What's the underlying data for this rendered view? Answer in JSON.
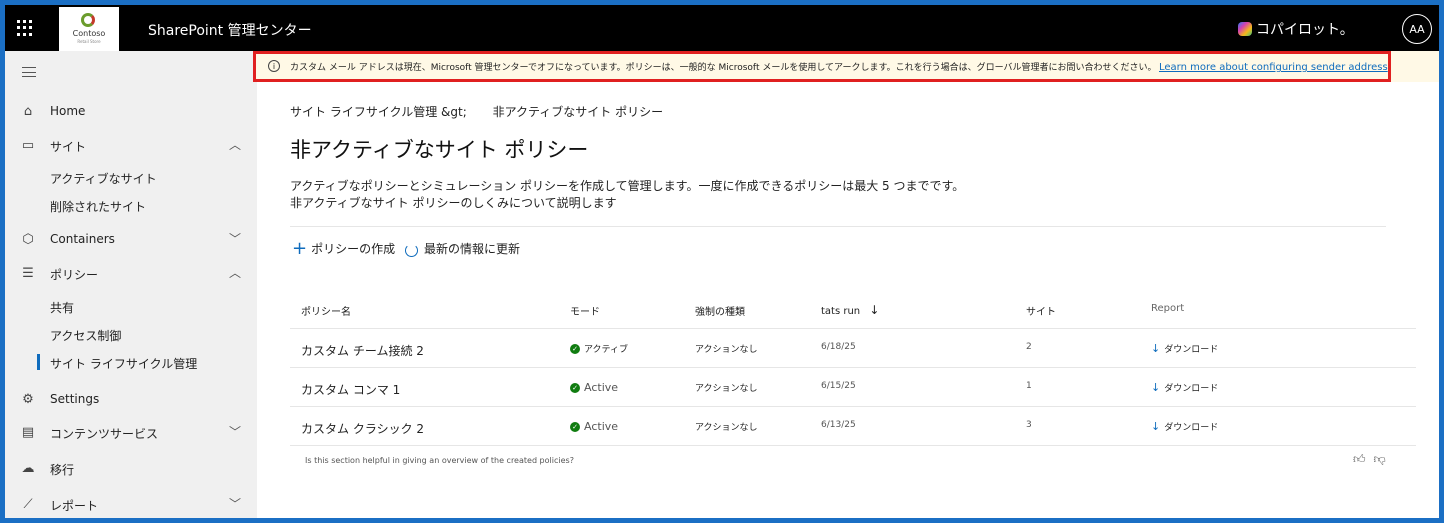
{
  "header": {
    "app_title": "SharePoint 管理センター",
    "logo_name": "Contoso",
    "logo_tagline": "Retail Store",
    "copilot_label": "コパイロット。",
    "avatar_initials": "AA"
  },
  "sidebar": {
    "items": [
      {
        "label": "Home",
        "icon": "home-icon"
      },
      {
        "label": "サイト",
        "icon": "sites-icon",
        "expanded": true
      },
      {
        "label": "アクティブなサイト"
      },
      {
        "label": "削除されたサイト"
      },
      {
        "label": "Containers",
        "icon": "containers-icon",
        "expanded": false
      },
      {
        "label": "ポリシー",
        "icon": "policies-icon",
        "expanded": true
      },
      {
        "label": "共有"
      },
      {
        "label": "アクセス制御"
      },
      {
        "label": "サイト ライフサイクル管理",
        "active": true
      },
      {
        "label": "Settings",
        "icon": "gear-icon"
      },
      {
        "label": "コンテンツサービス",
        "icon": "content-services-icon",
        "expanded": false
      },
      {
        "label": "移行",
        "icon": "migration-icon"
      },
      {
        "label": "レポート",
        "icon": "reports-icon",
        "expanded": false
      }
    ]
  },
  "banner": {
    "message": "カスタム メール アドレスは現在、Microsoft 管理センターでオフになっています。ポリシーは、一般的な Microsoft メールを使用してアークします。これを行う場合は、グローバル管理者にお問い合わせください。",
    "link": "Learn more about configuring sender address"
  },
  "breadcrumb": {
    "parent": "サイト ライフサイクル管理 &gt;",
    "current": "非アクティブなサイト ポリシー"
  },
  "page": {
    "title": "非アクティブなサイト ポリシー",
    "description_line1": "アクティブなポリシーとシミュレーション ポリシーを作成して管理します。一度に作成できるポリシーは最大 5 つまでです。",
    "description_line2": "非アクティブなサイト ポリシーのしくみについて説明します"
  },
  "commands": {
    "create": "ポリシーの作成",
    "refresh": "最新の情報に更新"
  },
  "table": {
    "columns": [
      "ポリシー名",
      "モード",
      "強制の種類",
      "tats run",
      "サイト",
      "Report"
    ],
    "sort_indicator": "↓",
    "rows": [
      {
        "name": "カスタム チーム接続 2",
        "mode": "アクティブ",
        "enforcement": "アクションなし",
        "last_run": "6/18/25",
        "sites": "2",
        "report": "ダウンロード"
      },
      {
        "name": "カスタム コンマ 1",
        "mode": "Active",
        "enforcement": "アクションなし",
        "last_run": "6/15/25",
        "sites": "1",
        "report": "ダウンロード"
      },
      {
        "name": "カスタム クラシック 2",
        "mode": "Active",
        "enforcement": "アクションなし",
        "last_run": "6/13/25",
        "sites": "3",
        "report": "ダウンロード"
      }
    ]
  },
  "feedback": {
    "question": "Is this section helpful in giving an overview of the created policies?"
  },
  "colors": {
    "accent": "#0f6cbd",
    "status_active": "#107c10",
    "banner_border": "#e02020",
    "banner_bg": "#fff9e6"
  }
}
